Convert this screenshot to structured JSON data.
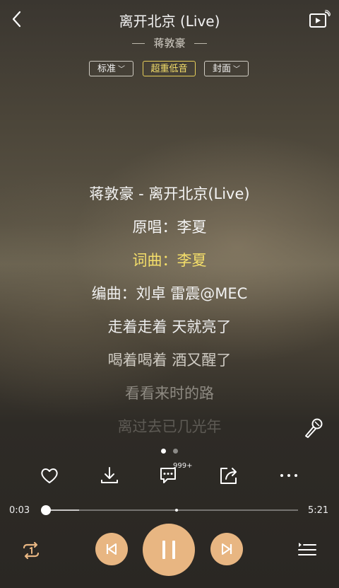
{
  "header": {
    "title": "离开北京 (Live)",
    "artist": "蒋敦豪",
    "tags": [
      {
        "label": "标准",
        "active": false,
        "dropdown": true
      },
      {
        "label": "超重低音",
        "active": true,
        "dropdown": false
      },
      {
        "label": "封面",
        "active": false,
        "dropdown": true
      }
    ]
  },
  "lyrics": [
    {
      "text": "蒋敦豪 - 离开北京(Live)"
    },
    {
      "text": "原唱：李夏"
    },
    {
      "text": "词曲：李夏",
      "highlight": true
    },
    {
      "text": "编曲：刘卓 雷震@MEC"
    },
    {
      "text": "走着走着 天就亮了"
    },
    {
      "text": "喝着喝着 酒又醒了"
    },
    {
      "text": "看看来时的路"
    },
    {
      "text": "离过去已几光年"
    }
  ],
  "actions": {
    "comment_count": "999+"
  },
  "progress": {
    "current": "0:03",
    "total": "5:21",
    "fraction": 0.0093
  },
  "colors": {
    "accent": "#e8b682",
    "highlight": "#f5df6a"
  },
  "icons": {
    "back": "chevron-left-icon",
    "cast": "cast-play-icon",
    "mic": "microphone-icon",
    "like": "heart-icon",
    "download": "download-icon",
    "comment": "comment-icon",
    "share": "share-icon",
    "more": "more-icon",
    "repeat": "repeat-one-icon",
    "prev": "previous-icon",
    "pause": "pause-icon",
    "next": "next-icon",
    "playlist": "playlist-icon"
  }
}
